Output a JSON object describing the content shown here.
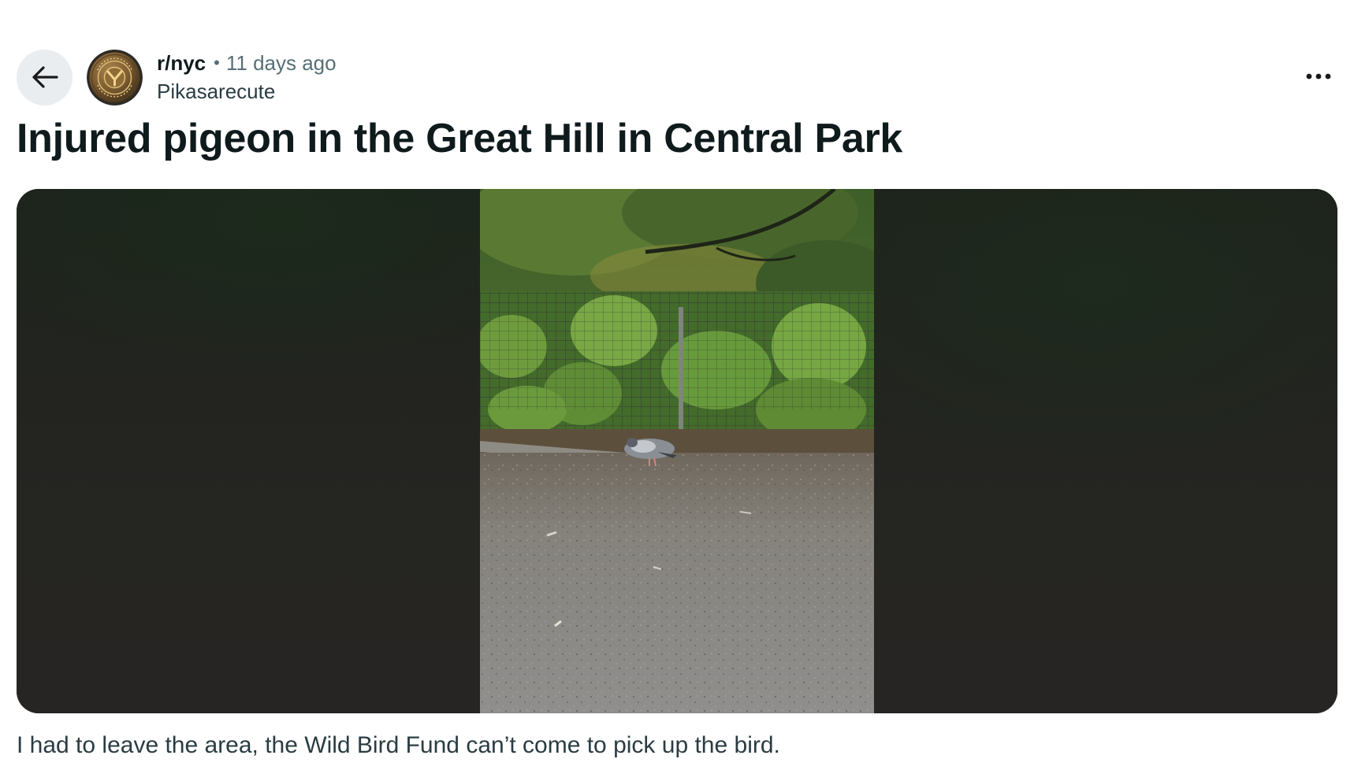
{
  "header": {
    "subreddit": "r/nyc",
    "separator": "•",
    "posted_ago": "11 days ago",
    "author": "Pikasarecute"
  },
  "icons": {
    "back": "arrow-left-icon",
    "avatar": "subreddit-avatar-token",
    "menu": "more-horizontal-icon"
  },
  "post": {
    "title": "Injured pigeon in the Great Hill in Central Park",
    "body": "I had to leave the area, the Wild Bird Fund can’t come to pick up the bird."
  },
  "colors": {
    "back_button_bg": "#eaedef",
    "meta_text": "#576f76",
    "title_text": "#0f1a1c",
    "media_bg": "#252523"
  }
}
